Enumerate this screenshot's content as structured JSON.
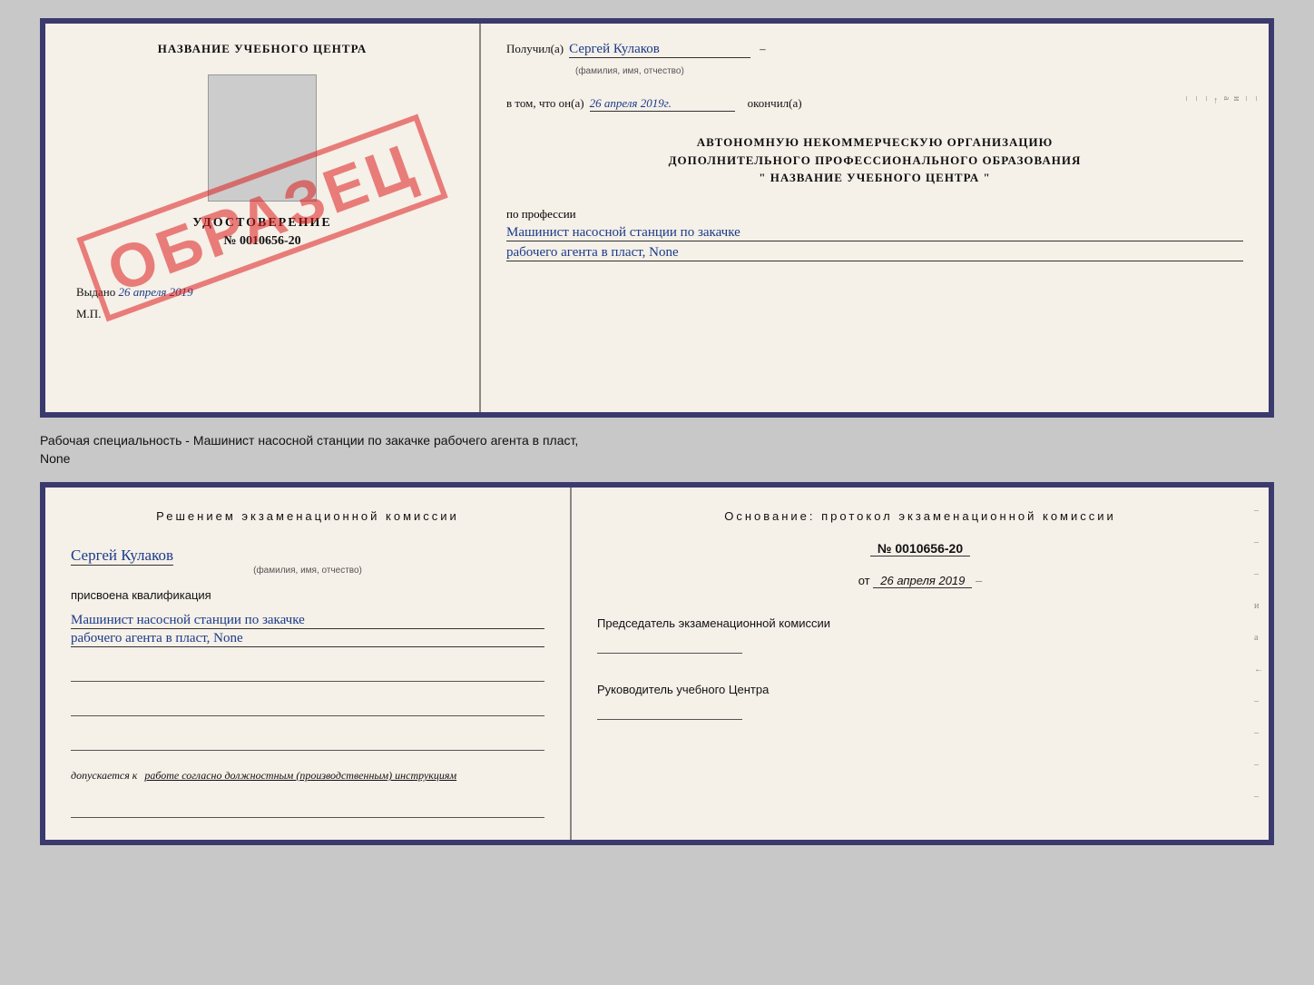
{
  "top_doc": {
    "left": {
      "title": "НАЗВАНИЕ УЧЕБНОГО ЦЕНТРА",
      "cert_label": "УДОСТОВЕРЕНИЕ",
      "cert_number": "№ 0010656-20",
      "issued_label": "Выдано",
      "issued_date": "26 апреля 2019",
      "mp_label": "М.П.",
      "stamp": "ОБРАЗЕЦ"
    },
    "right": {
      "received_label": "Получил(а)",
      "received_name": "Сергей Кулаков",
      "name_hint": "(фамилия, имя, отчество)",
      "in_that_label": "в том, что он(а)",
      "date_value": "26 апреля 2019г.",
      "finished_label": "окончил(а)",
      "org_line1": "АВТОНОМНУЮ НЕКОММЕРЧЕСКУЮ ОРГАНИЗАЦИЮ",
      "org_line2": "ДОПОЛНИТЕЛЬНОГО ПРОФЕССИОНАЛЬНОГО ОБРАЗОВАНИЯ",
      "org_line3": "\"  НАЗВАНИЕ УЧЕБНОГО ЦЕНТРА  \"",
      "profession_label": "по профессии",
      "profession_line1": "Машинист насосной станции по закачке",
      "profession_line2": "рабочего агента в пласт, None"
    }
  },
  "middle_text": {
    "line1": "Рабочая специальность - Машинист насосной станции по закачке рабочего агента в пласт,",
    "line2": "None"
  },
  "bottom_doc": {
    "left": {
      "decision_label": "Решением экзаменационной комиссии",
      "person_name": "Сергей Кулаков",
      "name_hint": "(фамилия, имя, отчество)",
      "qualification_label": "присвоена квалификация",
      "profession_line1": "Машинист насосной станции по закачке",
      "profession_line2": "рабочего агента в пласт, None",
      "blank1": "",
      "blank2": "",
      "blank3": "",
      "admission_label": "допускается к",
      "admission_text": "работе согласно должностным (производственным) инструкциям",
      "blank4": ""
    },
    "right": {
      "basis_label": "Основание: протокол экзаменационной комиссии",
      "protocol_number": "№ 0010656-20",
      "date_prefix": "от",
      "date_value": "26 апреля 2019",
      "chairman_label": "Председатель экзаменационной комиссии",
      "director_label": "Руководитель учебного Центра"
    }
  }
}
